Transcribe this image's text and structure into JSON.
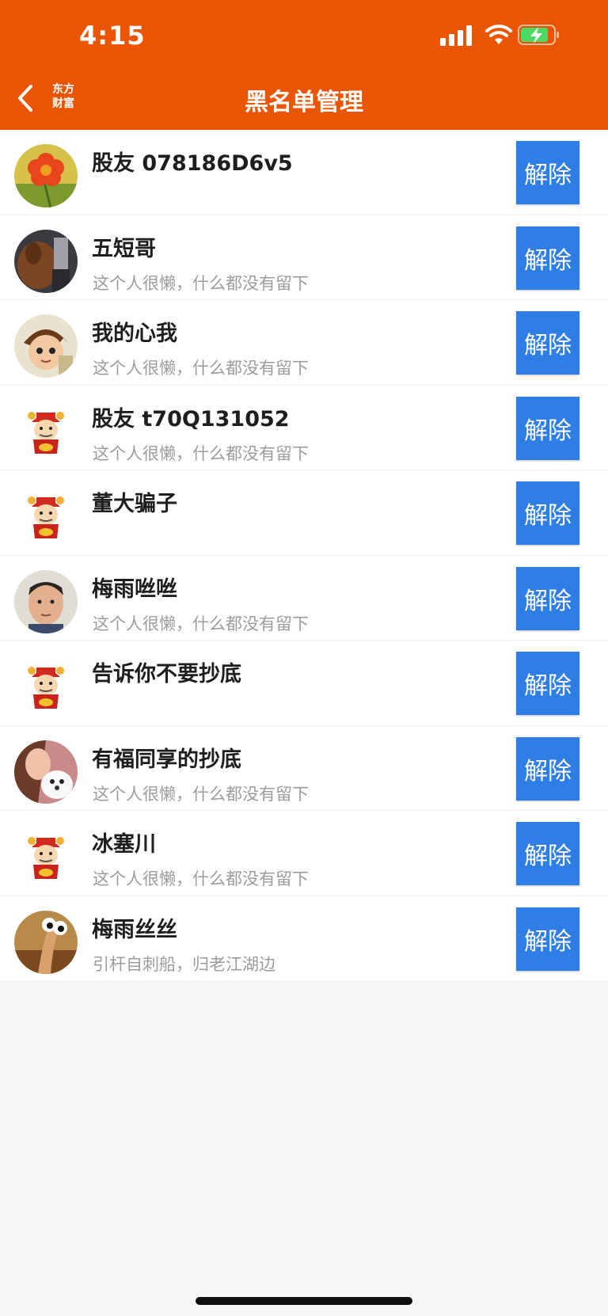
{
  "status_bar": {
    "time": "4:15"
  },
  "header": {
    "logo_line1": "东方",
    "logo_line2": "财富",
    "title": "黑名单管理"
  },
  "colors": {
    "brand": "#ea5504",
    "button": "#2f7ee6",
    "subtext": "#9c9c9c"
  },
  "list": [
    {
      "name": "股友 078186D6v5",
      "signature": "",
      "button": "解除",
      "avatar": "flower"
    },
    {
      "name": "五短哥",
      "signature": "这个人很懒，什么都没有留下",
      "button": "解除",
      "avatar": "horse"
    },
    {
      "name": "我的心我",
      "signature": "这个人很懒，什么都没有留下",
      "button": "解除",
      "avatar": "anime"
    },
    {
      "name": "股友 t70Q131052",
      "signature": "这个人很懒，什么都没有留下",
      "button": "解除",
      "avatar": "mascot"
    },
    {
      "name": "董大骗子",
      "signature": "",
      "button": "解除",
      "avatar": "mascot"
    },
    {
      "name": "梅雨咝咝",
      "signature": "这个人很懒，什么都没有留下",
      "button": "解除",
      "avatar": "face"
    },
    {
      "name": "告诉你不要抄底",
      "signature": "",
      "button": "解除",
      "avatar": "mascot"
    },
    {
      "name": "有福同享的抄底",
      "signature": "这个人很懒，什么都没有留下",
      "button": "解除",
      "avatar": "dog"
    },
    {
      "name": "冰塞川",
      "signature": "这个人很懒，什么都没有留下",
      "button": "解除",
      "avatar": "mascot"
    },
    {
      "name": "梅雨丝丝",
      "signature": "引杆自刺船，归老江湖边",
      "button": "解除",
      "avatar": "eyes"
    }
  ]
}
